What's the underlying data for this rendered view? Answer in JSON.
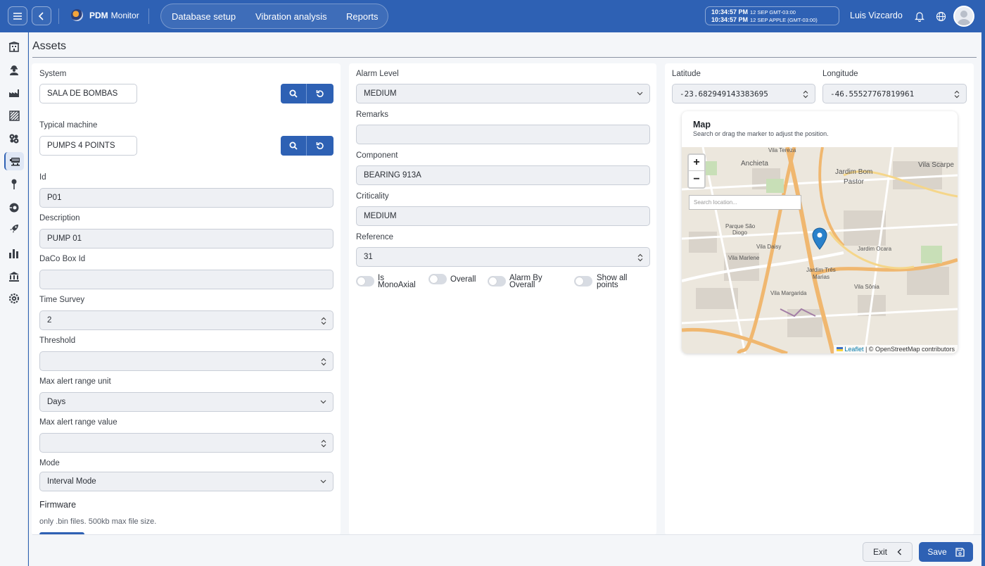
{
  "topbar": {
    "brand_bold": "PDM",
    "brand_rest": "Monitor",
    "nav": [
      "Database setup",
      "Vibration analysis",
      "Reports"
    ],
    "clock": [
      {
        "time": "10:34:57 PM",
        "zone": "12 SEP  GMT-03:00"
      },
      {
        "time": "10:34:57 PM",
        "zone": "12 SEP  APPLE (GMT-03:00)"
      }
    ],
    "user": "Luis Vizcardo"
  },
  "page": {
    "title": "Assets"
  },
  "left": {
    "system_label": "System",
    "system_value": "SALA DE BOMBAS",
    "typical_label": "Typical machine",
    "typical_value": "PUMPS 4 POINTS",
    "id_label": "Id",
    "id_value": "P01",
    "desc_label": "Description",
    "desc_value": "PUMP 01",
    "daco_label": "DaCo Box Id",
    "daco_value": "",
    "time_label": "Time Survey",
    "time_value": "2",
    "threshold_label": "Threshold",
    "threshold_value": "",
    "unit_label": "Max alert range unit",
    "unit_value": "Days",
    "range_label": "Max alert range value",
    "range_value": "",
    "mode_label": "Mode",
    "mode_value": "Interval Mode",
    "firmware_label": "Firmware",
    "firmware_hint": "only .bin files. 500kb max file size."
  },
  "middle": {
    "alarm_label": "Alarm Level",
    "alarm_value": "MEDIUM",
    "remarks_label": "Remarks",
    "remarks_value": "",
    "component_label": "Component",
    "component_value": "BEARING 913A",
    "criticality_label": "Criticality",
    "criticality_value": "MEDIUM",
    "reference_label": "Reference",
    "reference_value": "31",
    "toggles": [
      {
        "line1": "Is",
        "line2": "MonoAxial",
        "on": false
      },
      {
        "line1": "Overall",
        "line2": "",
        "on": false
      },
      {
        "line1": "Alarm By",
        "line2": "Overall",
        "on": false
      },
      {
        "line1": "Show all",
        "line2": "points",
        "on": false
      }
    ]
  },
  "right": {
    "lat_label": "Latitude",
    "lat_value": "-23.682949143383695",
    "lng_label": "Longitude",
    "lng_value": "-46.55527767819961",
    "map_title": "Map",
    "map_subtitle": "Search or drag the marker to adjust the position.",
    "map_search_placeholder": "Search location...",
    "zoom_in": "+",
    "zoom_out": "−",
    "attribution_leaflet": "Leaflet",
    "attribution_rest": "| © OpenStreetMap contributors",
    "map_labels": [
      "Vila Tereza",
      "Anchieta",
      "Jardim Bom",
      "Pastor",
      "Vila Scarpe",
      "Parque São",
      "Diogo",
      "Vila Daisy",
      "Jardim Ocara",
      "Vila Marlene",
      "Jardim Três",
      "Marias",
      "Vila Sônia",
      "Vila Margarida"
    ]
  },
  "footer": {
    "exit_label": "Exit",
    "save_label": "Save"
  },
  "colors": {
    "primary": "#2e61b4",
    "field_bg": "#eef0f4",
    "page_bg": "#f4f6f9"
  }
}
